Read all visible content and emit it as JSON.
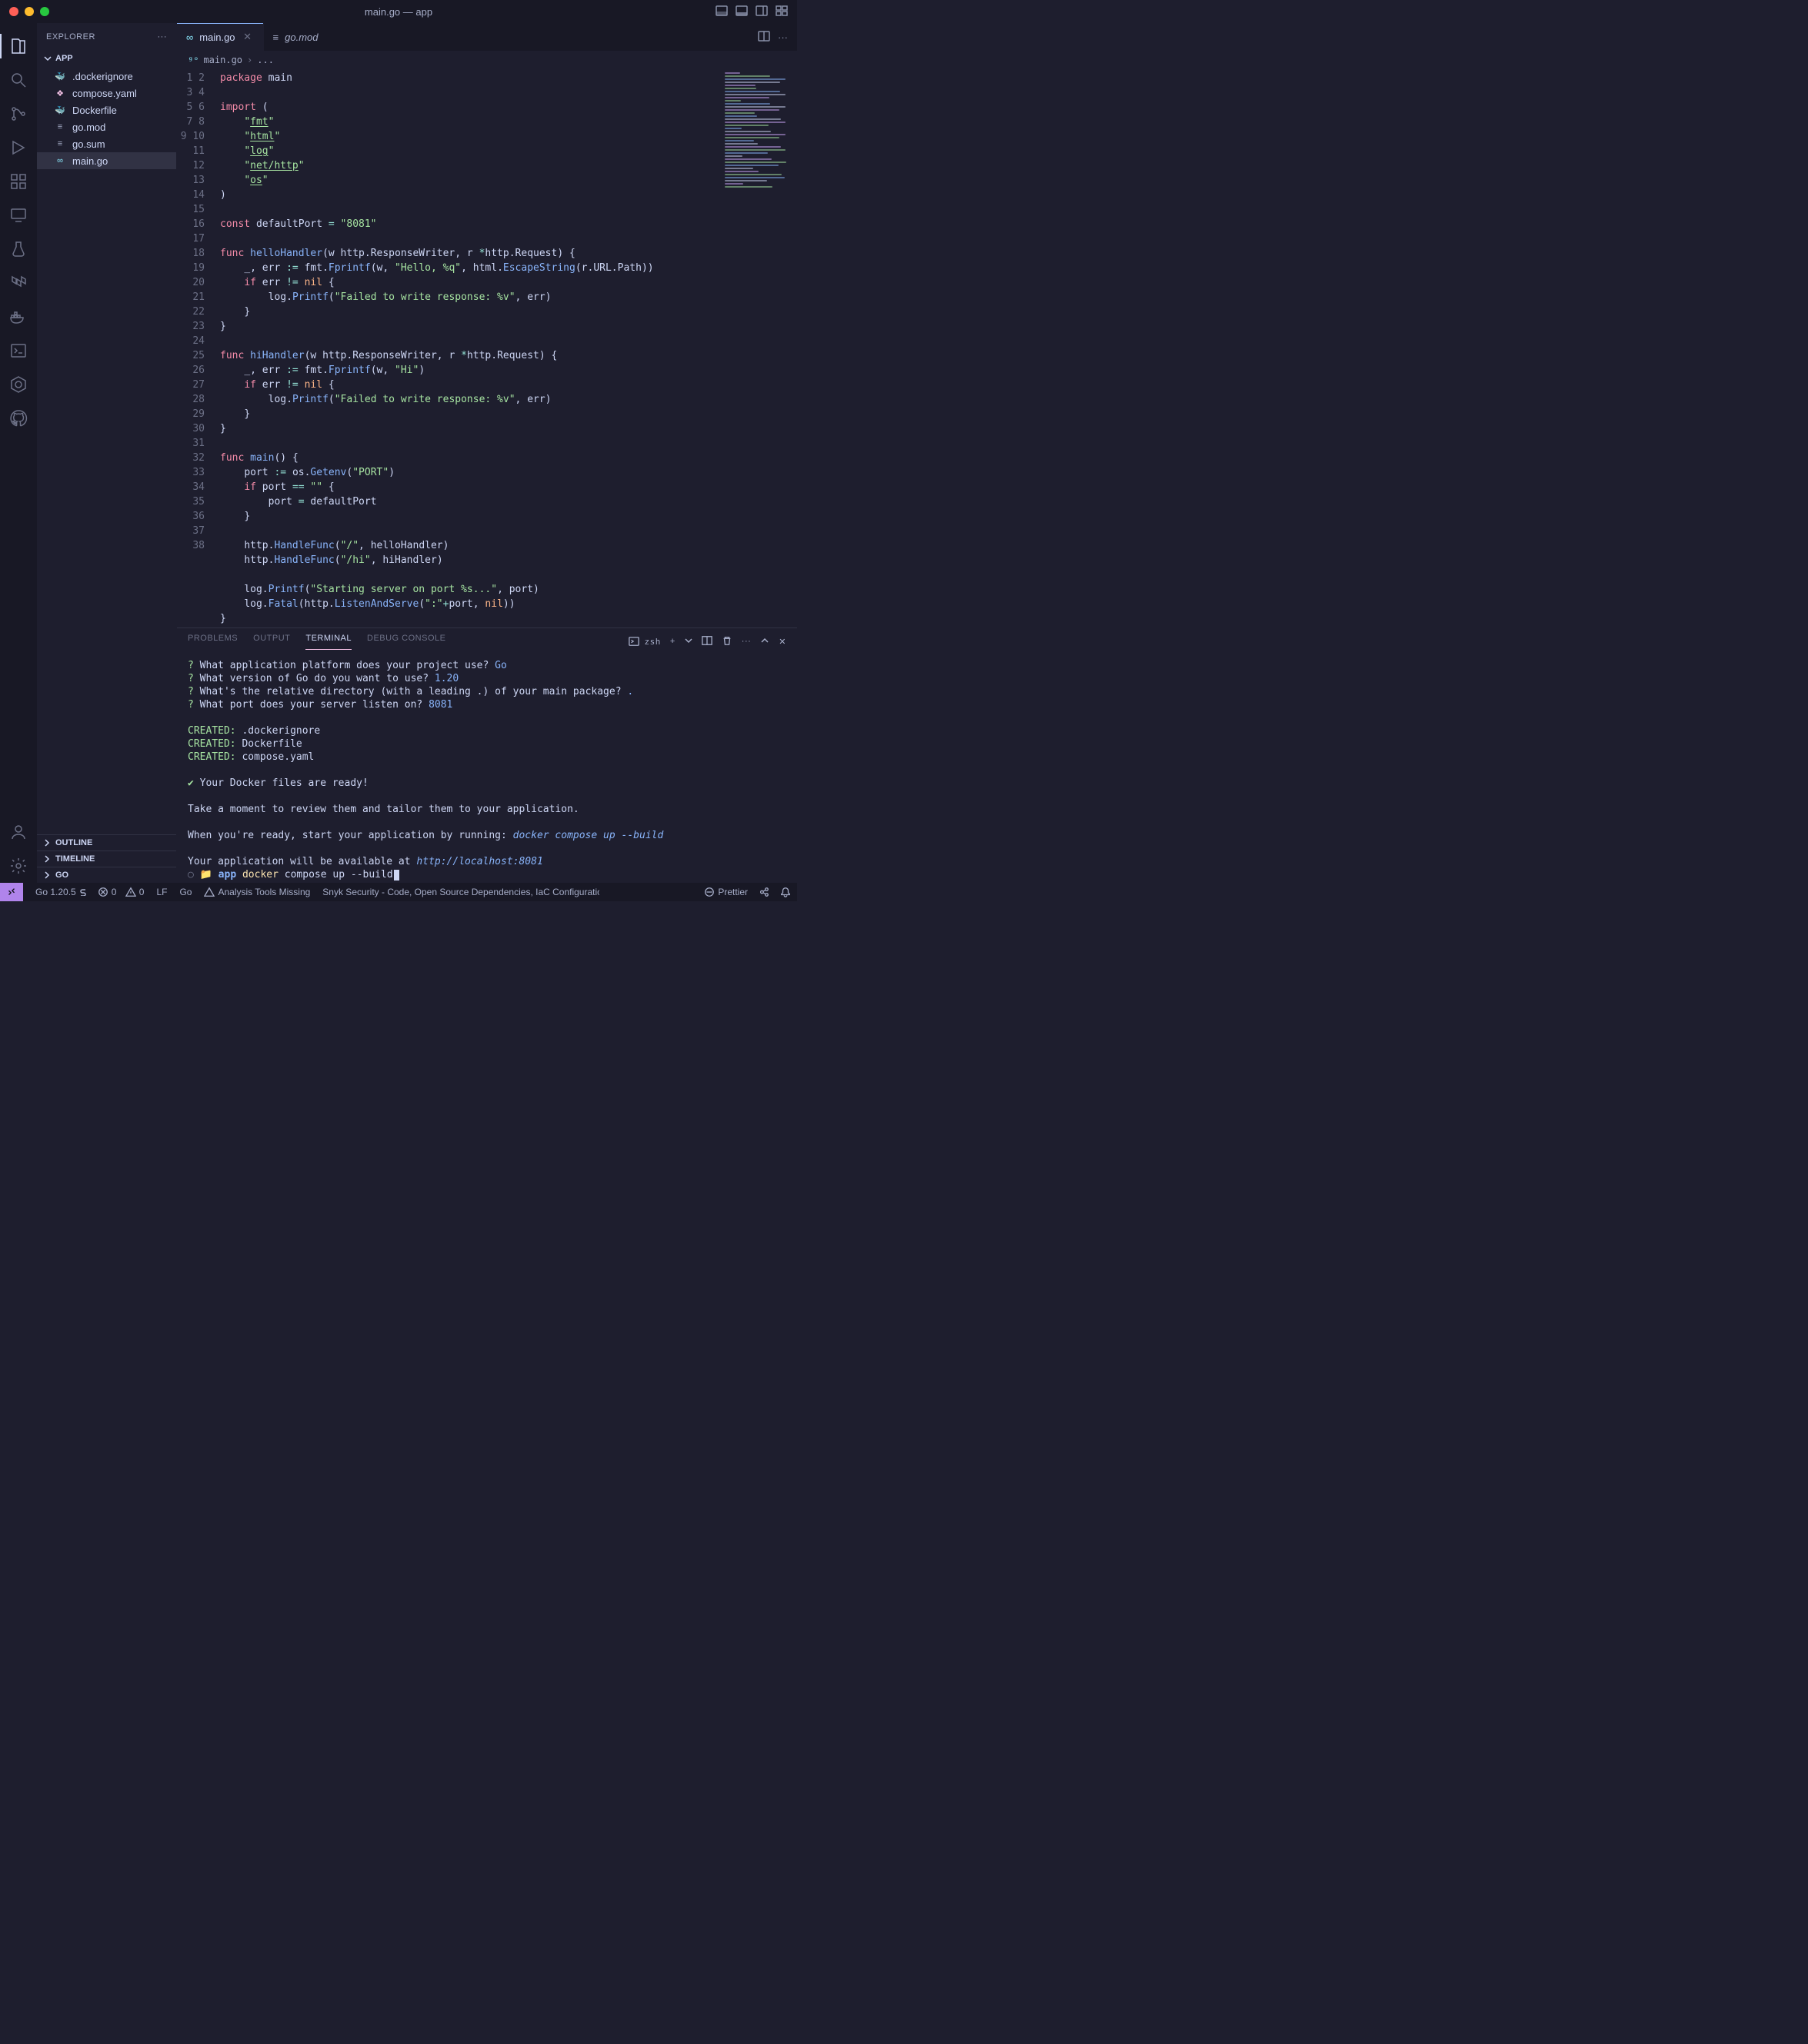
{
  "window": {
    "title": "main.go — app"
  },
  "sidebar": {
    "header": "EXPLORER",
    "root": "APP",
    "files": [
      {
        "name": ".dockerignore",
        "icon": "docker",
        "tone": "gray"
      },
      {
        "name": "compose.yaml",
        "icon": "compose",
        "tone": "pink"
      },
      {
        "name": "Dockerfile",
        "icon": "docker",
        "tone": "docker"
      },
      {
        "name": "go.mod",
        "icon": "lines",
        "tone": "gray"
      },
      {
        "name": "go.sum",
        "icon": "lines",
        "tone": "gray"
      },
      {
        "name": "main.go",
        "icon": "go",
        "tone": "go",
        "selected": true
      }
    ],
    "collapsed": [
      "OUTLINE",
      "TIMELINE",
      "GO"
    ]
  },
  "tabs": {
    "items": [
      {
        "label": "main.go",
        "icon": "go",
        "active": true,
        "close": true
      },
      {
        "label": "go.mod",
        "icon": "lines",
        "active": false,
        "close": false
      }
    ]
  },
  "breadcrumb": {
    "file": "main.go",
    "more": "..."
  },
  "code": {
    "lines": 38,
    "tokens": [
      [
        [
          "kw2",
          "package"
        ],
        [
          "sp",
          " "
        ],
        [
          "ident",
          "main"
        ]
      ],
      [],
      [
        [
          "kw2",
          "import"
        ],
        [
          "sp",
          " "
        ],
        [
          "pun",
          "("
        ]
      ],
      [
        [
          "sp",
          "    "
        ],
        [
          "str",
          "\""
        ],
        [
          "str und",
          "fmt"
        ],
        [
          "str",
          "\""
        ]
      ],
      [
        [
          "sp",
          "    "
        ],
        [
          "str",
          "\""
        ],
        [
          "str und",
          "html"
        ],
        [
          "str",
          "\""
        ]
      ],
      [
        [
          "sp",
          "    "
        ],
        [
          "str",
          "\""
        ],
        [
          "str und",
          "log"
        ],
        [
          "str",
          "\""
        ]
      ],
      [
        [
          "sp",
          "    "
        ],
        [
          "str",
          "\""
        ],
        [
          "str und",
          "net/http"
        ],
        [
          "str",
          "\""
        ]
      ],
      [
        [
          "sp",
          "    "
        ],
        [
          "str",
          "\""
        ],
        [
          "str und",
          "os"
        ],
        [
          "str",
          "\""
        ]
      ],
      [
        [
          "pun",
          ")"
        ]
      ],
      [],
      [
        [
          "kw2",
          "const"
        ],
        [
          "sp",
          " "
        ],
        [
          "ident",
          "defaultPort"
        ],
        [
          "sp",
          " "
        ],
        [
          "op",
          "="
        ],
        [
          "sp",
          " "
        ],
        [
          "str",
          "\"8081\""
        ]
      ],
      [],
      [
        [
          "kw2",
          "func"
        ],
        [
          "sp",
          " "
        ],
        [
          "fn",
          "helloHandler"
        ],
        [
          "pun",
          "("
        ],
        [
          "ident",
          "w http"
        ],
        [
          "pun",
          "."
        ],
        [
          "ident",
          "ResponseWriter"
        ],
        [
          "pun",
          ", "
        ],
        [
          "ident",
          "r "
        ],
        [
          "op",
          "*"
        ],
        [
          "ident",
          "http"
        ],
        [
          "pun",
          "."
        ],
        [
          "ident",
          "Request"
        ],
        [
          "pun",
          ") "
        ],
        [
          "pun",
          "{"
        ]
      ],
      [
        [
          "sp",
          "    "
        ],
        [
          "ident",
          "_"
        ],
        [
          "pun",
          ", "
        ],
        [
          "ident",
          "err"
        ],
        [
          "sp",
          " "
        ],
        [
          "op",
          ":="
        ],
        [
          "sp",
          " "
        ],
        [
          "ident",
          "fmt"
        ],
        [
          "pun",
          "."
        ],
        [
          "fn",
          "Fprintf"
        ],
        [
          "pun",
          "("
        ],
        [
          "ident",
          "w"
        ],
        [
          "pun",
          ", "
        ],
        [
          "str",
          "\"Hello, %q\""
        ],
        [
          "pun",
          ", "
        ],
        [
          "ident",
          "html"
        ],
        [
          "pun",
          "."
        ],
        [
          "fn",
          "EscapeString"
        ],
        [
          "pun",
          "("
        ],
        [
          "ident",
          "r"
        ],
        [
          "pun",
          "."
        ],
        [
          "ident",
          "URL"
        ],
        [
          "pun",
          "."
        ],
        [
          "ident",
          "Path"
        ],
        [
          "pun",
          "))"
        ]
      ],
      [
        [
          "sp",
          "    "
        ],
        [
          "kw2",
          "if"
        ],
        [
          "sp",
          " "
        ],
        [
          "ident",
          "err"
        ],
        [
          "sp",
          " "
        ],
        [
          "op",
          "!="
        ],
        [
          "sp",
          " "
        ],
        [
          "num",
          "nil"
        ],
        [
          "sp",
          " "
        ],
        [
          "pun",
          "{"
        ]
      ],
      [
        [
          "sp",
          "        "
        ],
        [
          "ident",
          "log"
        ],
        [
          "pun",
          "."
        ],
        [
          "fn",
          "Printf"
        ],
        [
          "pun",
          "("
        ],
        [
          "str",
          "\"Failed to write response: %v\""
        ],
        [
          "pun",
          ", "
        ],
        [
          "ident",
          "err"
        ],
        [
          "pun",
          ")"
        ]
      ],
      [
        [
          "sp",
          "    "
        ],
        [
          "pun",
          "}"
        ]
      ],
      [
        [
          "pun",
          "}"
        ]
      ],
      [],
      [
        [
          "kw2",
          "func"
        ],
        [
          "sp",
          " "
        ],
        [
          "fn",
          "hiHandler"
        ],
        [
          "pun",
          "("
        ],
        [
          "ident",
          "w http"
        ],
        [
          "pun",
          "."
        ],
        [
          "ident",
          "ResponseWriter"
        ],
        [
          "pun",
          ", "
        ],
        [
          "ident",
          "r "
        ],
        [
          "op",
          "*"
        ],
        [
          "ident",
          "http"
        ],
        [
          "pun",
          "."
        ],
        [
          "ident",
          "Request"
        ],
        [
          "pun",
          ") "
        ],
        [
          "pun",
          "{"
        ]
      ],
      [
        [
          "sp",
          "    "
        ],
        [
          "ident",
          "_"
        ],
        [
          "pun",
          ", "
        ],
        [
          "ident",
          "err"
        ],
        [
          "sp",
          " "
        ],
        [
          "op",
          ":="
        ],
        [
          "sp",
          " "
        ],
        [
          "ident",
          "fmt"
        ],
        [
          "pun",
          "."
        ],
        [
          "fn",
          "Fprintf"
        ],
        [
          "pun",
          "("
        ],
        [
          "ident",
          "w"
        ],
        [
          "pun",
          ", "
        ],
        [
          "str",
          "\"Hi\""
        ],
        [
          "pun",
          ")"
        ]
      ],
      [
        [
          "sp",
          "    "
        ],
        [
          "kw2",
          "if"
        ],
        [
          "sp",
          " "
        ],
        [
          "ident",
          "err"
        ],
        [
          "sp",
          " "
        ],
        [
          "op",
          "!="
        ],
        [
          "sp",
          " "
        ],
        [
          "num",
          "nil"
        ],
        [
          "sp",
          " "
        ],
        [
          "pun",
          "{"
        ]
      ],
      [
        [
          "sp",
          "        "
        ],
        [
          "ident",
          "log"
        ],
        [
          "pun",
          "."
        ],
        [
          "fn",
          "Printf"
        ],
        [
          "pun",
          "("
        ],
        [
          "str",
          "\"Failed to write response: %v\""
        ],
        [
          "pun",
          ", "
        ],
        [
          "ident",
          "err"
        ],
        [
          "pun",
          ")"
        ]
      ],
      [
        [
          "sp",
          "    "
        ],
        [
          "pun",
          "}"
        ]
      ],
      [
        [
          "pun",
          "}"
        ]
      ],
      [],
      [
        [
          "kw2",
          "func"
        ],
        [
          "sp",
          " "
        ],
        [
          "fn",
          "main"
        ],
        [
          "pun",
          "() "
        ],
        [
          "pun",
          "{"
        ]
      ],
      [
        [
          "sp",
          "    "
        ],
        [
          "ident",
          "port"
        ],
        [
          "sp",
          " "
        ],
        [
          "op",
          ":="
        ],
        [
          "sp",
          " "
        ],
        [
          "ident",
          "os"
        ],
        [
          "pun",
          "."
        ],
        [
          "fn",
          "Getenv"
        ],
        [
          "pun",
          "("
        ],
        [
          "str",
          "\"PORT\""
        ],
        [
          "pun",
          ")"
        ]
      ],
      [
        [
          "sp",
          "    "
        ],
        [
          "kw2",
          "if"
        ],
        [
          "sp",
          " "
        ],
        [
          "ident",
          "port"
        ],
        [
          "sp",
          " "
        ],
        [
          "op",
          "=="
        ],
        [
          "sp",
          " "
        ],
        [
          "str",
          "\"\""
        ],
        [
          "sp",
          " "
        ],
        [
          "pun",
          "{"
        ]
      ],
      [
        [
          "sp",
          "        "
        ],
        [
          "ident",
          "port"
        ],
        [
          "sp",
          " "
        ],
        [
          "op",
          "="
        ],
        [
          "sp",
          " "
        ],
        [
          "ident",
          "defaultPort"
        ]
      ],
      [
        [
          "sp",
          "    "
        ],
        [
          "pun",
          "}"
        ]
      ],
      [],
      [
        [
          "sp",
          "    "
        ],
        [
          "ident",
          "http"
        ],
        [
          "pun",
          "."
        ],
        [
          "fn",
          "HandleFunc"
        ],
        [
          "pun",
          "("
        ],
        [
          "str",
          "\"/\""
        ],
        [
          "pun",
          ", "
        ],
        [
          "ident",
          "helloHandler"
        ],
        [
          "pun",
          ")"
        ]
      ],
      [
        [
          "sp",
          "    "
        ],
        [
          "ident",
          "http"
        ],
        [
          "pun",
          "."
        ],
        [
          "fn",
          "HandleFunc"
        ],
        [
          "pun",
          "("
        ],
        [
          "str",
          "\"/hi\""
        ],
        [
          "pun",
          ", "
        ],
        [
          "ident",
          "hiHandler"
        ],
        [
          "pun",
          ")"
        ]
      ],
      [],
      [
        [
          "sp",
          "    "
        ],
        [
          "ident",
          "log"
        ],
        [
          "pun",
          "."
        ],
        [
          "fn",
          "Printf"
        ],
        [
          "pun",
          "("
        ],
        [
          "str",
          "\"Starting server on port %s...\""
        ],
        [
          "pun",
          ", "
        ],
        [
          "ident",
          "port"
        ],
        [
          "pun",
          ")"
        ]
      ],
      [
        [
          "sp",
          "    "
        ],
        [
          "ident",
          "log"
        ],
        [
          "pun",
          "."
        ],
        [
          "fn",
          "Fatal"
        ],
        [
          "pun",
          "("
        ],
        [
          "ident",
          "http"
        ],
        [
          "pun",
          "."
        ],
        [
          "fn",
          "ListenAndServe"
        ],
        [
          "pun",
          "("
        ],
        [
          "str",
          "\":\""
        ],
        [
          "op",
          "+"
        ],
        [
          "ident",
          "port"
        ],
        [
          "pun",
          ", "
        ],
        [
          "num",
          "nil"
        ],
        [
          "pun",
          "))"
        ]
      ],
      [
        [
          "pun",
          "}"
        ]
      ]
    ]
  },
  "panel": {
    "tabs": [
      "PROBLEMS",
      "OUTPUT",
      "TERMINAL",
      "DEBUG CONSOLE"
    ],
    "active": "TERMINAL",
    "shell": "zsh",
    "terminal": {
      "questions": [
        {
          "q": "What application platform does your project use?",
          "a": "Go"
        },
        {
          "q": "What version of Go do you want to use?",
          "a": "1.20"
        },
        {
          "q": "What's the relative directory (with a leading .) of your main package?",
          "a": "."
        },
        {
          "q": "What port does your server listen on?",
          "a": "8081"
        }
      ],
      "created": [
        ".dockerignore",
        "Dockerfile",
        "compose.yaml"
      ],
      "ready": "Your Docker files are ready!",
      "review": "Take a moment to review them and tailor them to your application.",
      "start_prefix": "When you're ready, start your application by running:",
      "start_cmd": "docker compose up --build",
      "avail_prefix": "Your application will be available at",
      "avail_url": "http://localhost:8081",
      "prompt_dir": "app",
      "prompt_cmd": "docker",
      "prompt_rest": "compose up --build"
    }
  },
  "status": {
    "go": "Go 1.20.5",
    "errors": "0",
    "warnings": "0",
    "lf": "LF",
    "lang": "Go",
    "analysis": "Analysis Tools Missing",
    "snyk": "Snyk Security - Code, Open Source Dependencies, IaC Configuratio",
    "prettier": "Prettier"
  }
}
